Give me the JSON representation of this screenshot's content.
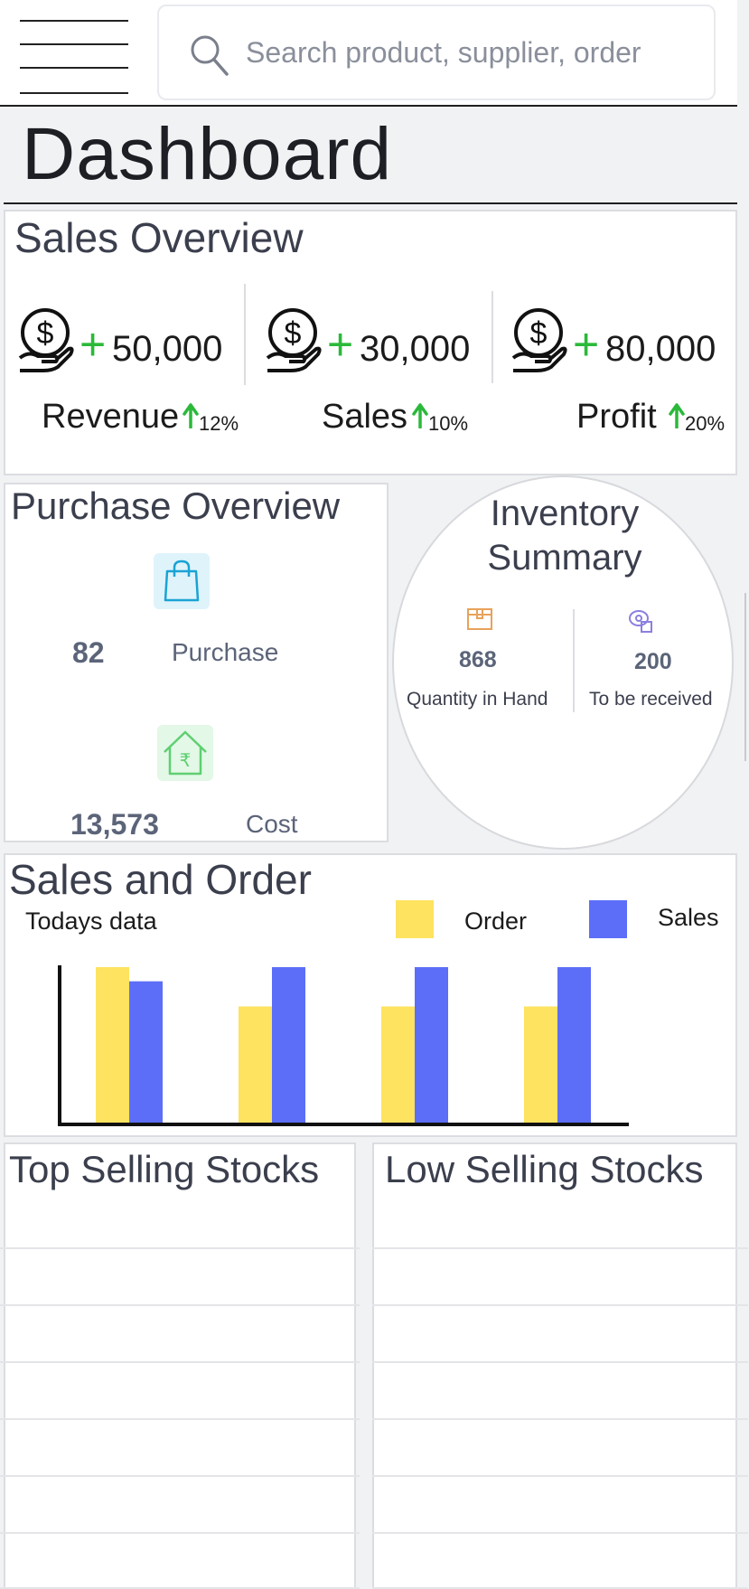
{
  "search": {
    "placeholder": "Search product, supplier, order"
  },
  "page": {
    "title": "Dashboard"
  },
  "sales_overview": {
    "title": "Sales Overview",
    "metrics": [
      {
        "plus": "+",
        "value": "50,000",
        "label": "Revenue",
        "change": "12%"
      },
      {
        "plus": "+",
        "value": "30,000",
        "label": "Sales",
        "change": "10%"
      },
      {
        "plus": "+",
        "value": "80,000",
        "label": "Profit",
        "change": "20%"
      }
    ]
  },
  "purchase_overview": {
    "title": "Purchase Overview",
    "items": [
      {
        "value": "82",
        "label": "Purchase"
      },
      {
        "value": "13,573",
        "label": "Cost"
      }
    ]
  },
  "inventory_summary": {
    "title_line1": "Inventory",
    "title_line2": "Summary",
    "items": [
      {
        "value": "868",
        "label": "Quantity in Hand"
      },
      {
        "value": "200",
        "label": "To be received"
      }
    ]
  },
  "sales_and_order": {
    "title": "Sales and Order",
    "subtitle": "Todays data",
    "legend": [
      {
        "label": "Order",
        "color": "#fde35f"
      },
      {
        "label": "Sales",
        "color": "#5c6ef8"
      }
    ]
  },
  "chart_data": {
    "type": "bar",
    "title": "Sales and Order",
    "subtitle": "Todays data",
    "categories": [
      "",
      "",
      "",
      ""
    ],
    "series": [
      {
        "name": "Order",
        "color": "#fde35f",
        "values": [
          100,
          75,
          75,
          75
        ]
      },
      {
        "name": "Sales",
        "color": "#5c6ef8",
        "values": [
          91,
          100,
          100,
          100
        ]
      }
    ],
    "ylim": [
      0,
      100
    ],
    "legend": "top-right",
    "grid": false
  },
  "top_selling": {
    "title": "Top Selling Stocks"
  },
  "low_selling": {
    "title": "Low Selling Stocks"
  },
  "colors": {
    "accent_green": "#2bb93a",
    "bar_order": "#fde35f",
    "bar_sales": "#5c6ef8",
    "purchase_icon_bg": "#dff3fb",
    "cost_icon_bg": "#e3f8e6"
  }
}
